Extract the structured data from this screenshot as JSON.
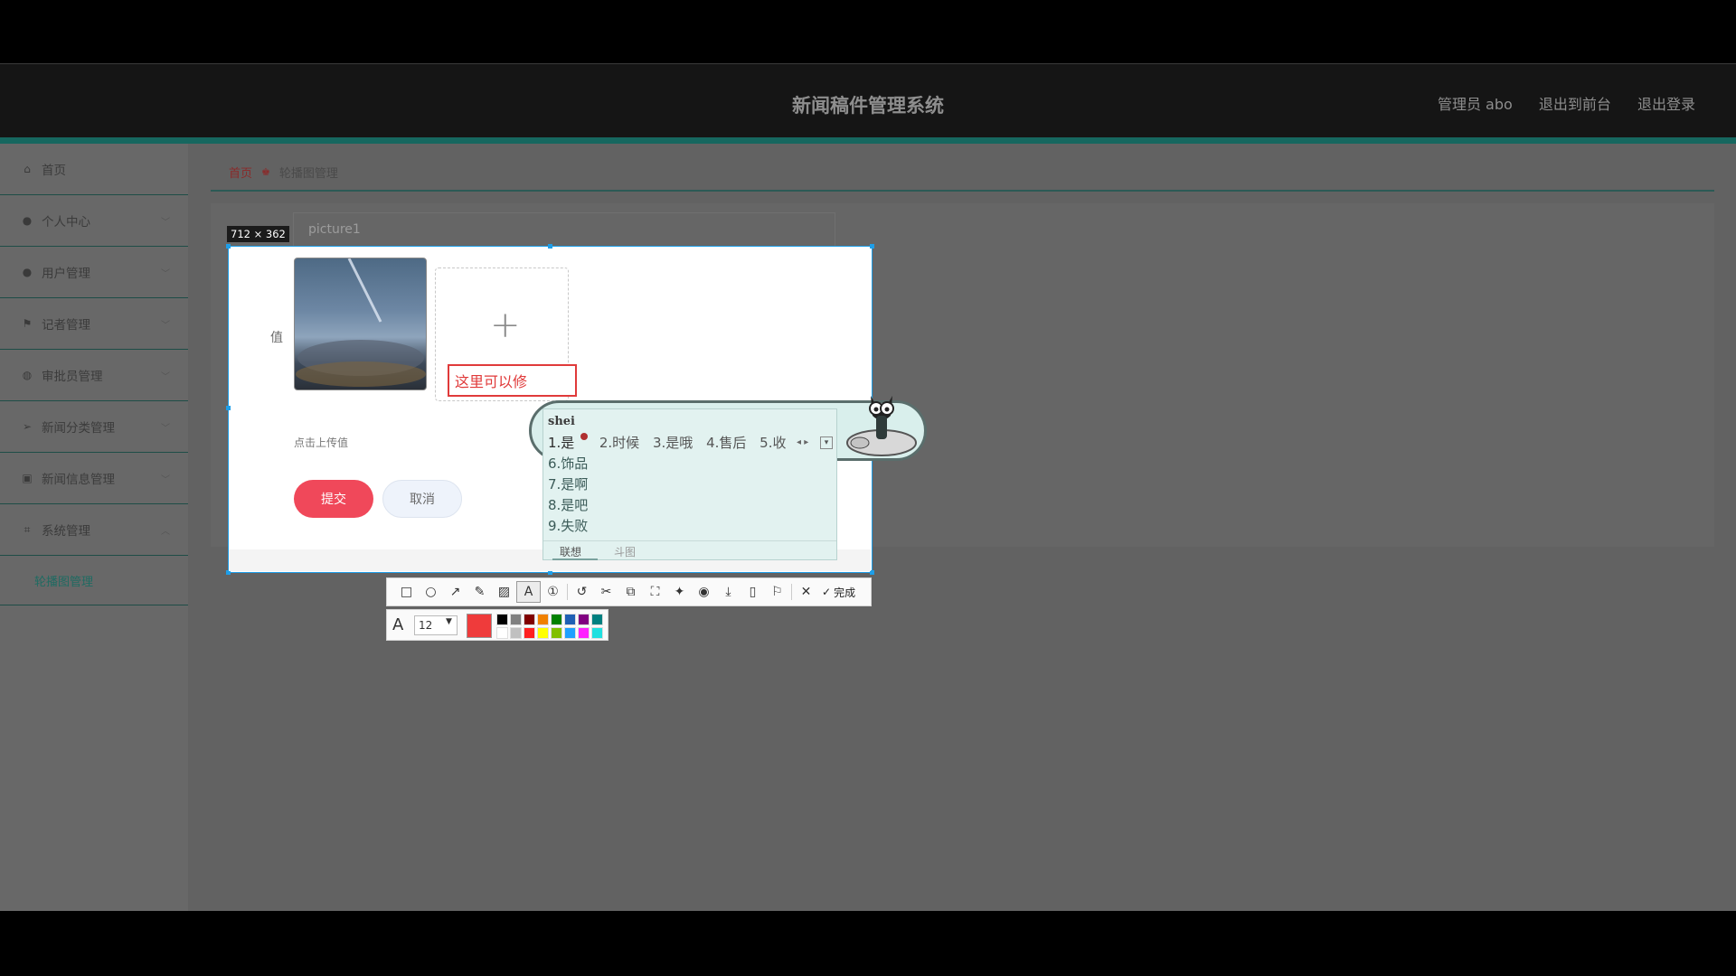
{
  "header": {
    "app_title": "新闻稿件管理系统",
    "links": [
      "管理员 abo",
      "退出到前台",
      "退出登录"
    ]
  },
  "sidebar": {
    "items": [
      {
        "label": "首页",
        "icon": "home-icon",
        "has_chevron": false
      },
      {
        "label": "个人中心",
        "icon": "user-icon",
        "has_chevron": true
      },
      {
        "label": "用户管理",
        "icon": "person-icon",
        "has_chevron": true
      },
      {
        "label": "记者管理",
        "icon": "flag-icon",
        "has_chevron": true
      },
      {
        "label": "审批员管理",
        "icon": "globe-icon",
        "has_chevron": true
      },
      {
        "label": "新闻分类管理",
        "icon": "send-icon",
        "has_chevron": true
      },
      {
        "label": "新闻信息管理",
        "icon": "picture-icon",
        "has_chevron": true
      },
      {
        "label": "系统管理",
        "icon": "crop-icon",
        "has_chevron": true
      }
    ],
    "sub_item": "轮播图管理"
  },
  "breadcrumb": {
    "home": "首页",
    "current": "轮播图管理"
  },
  "form": {
    "key_value": "picture1",
    "value_label": "值",
    "upload_hint": "点击上传值",
    "submit_label": "提交",
    "cancel_label": "取消"
  },
  "screenshot_tool": {
    "dimensions": "712 × 362",
    "annotation_text": "这里可以修",
    "font_size": "12",
    "current_color": "#ef3b3b",
    "done_label": "完成",
    "palette": [
      "#000000",
      "#808080",
      "#800000",
      "#f08000",
      "#008000",
      "#1e5fb4",
      "#800080",
      "#008080",
      "#ffffff",
      "#c0c0c0",
      "#ff2020",
      "#ffff00",
      "#80c000",
      "#1ea0ff",
      "#ff20ff",
      "#20e0e0"
    ]
  },
  "ime": {
    "pinyin": "shei",
    "candidates": [
      "1.是",
      "2.时候",
      "3.是哦",
      "4.售后",
      "5.收"
    ],
    "more": [
      "6.饰品",
      "7.是啊",
      "8.是吧",
      "9.失败"
    ],
    "tabs": [
      "联想",
      "斗图"
    ]
  }
}
